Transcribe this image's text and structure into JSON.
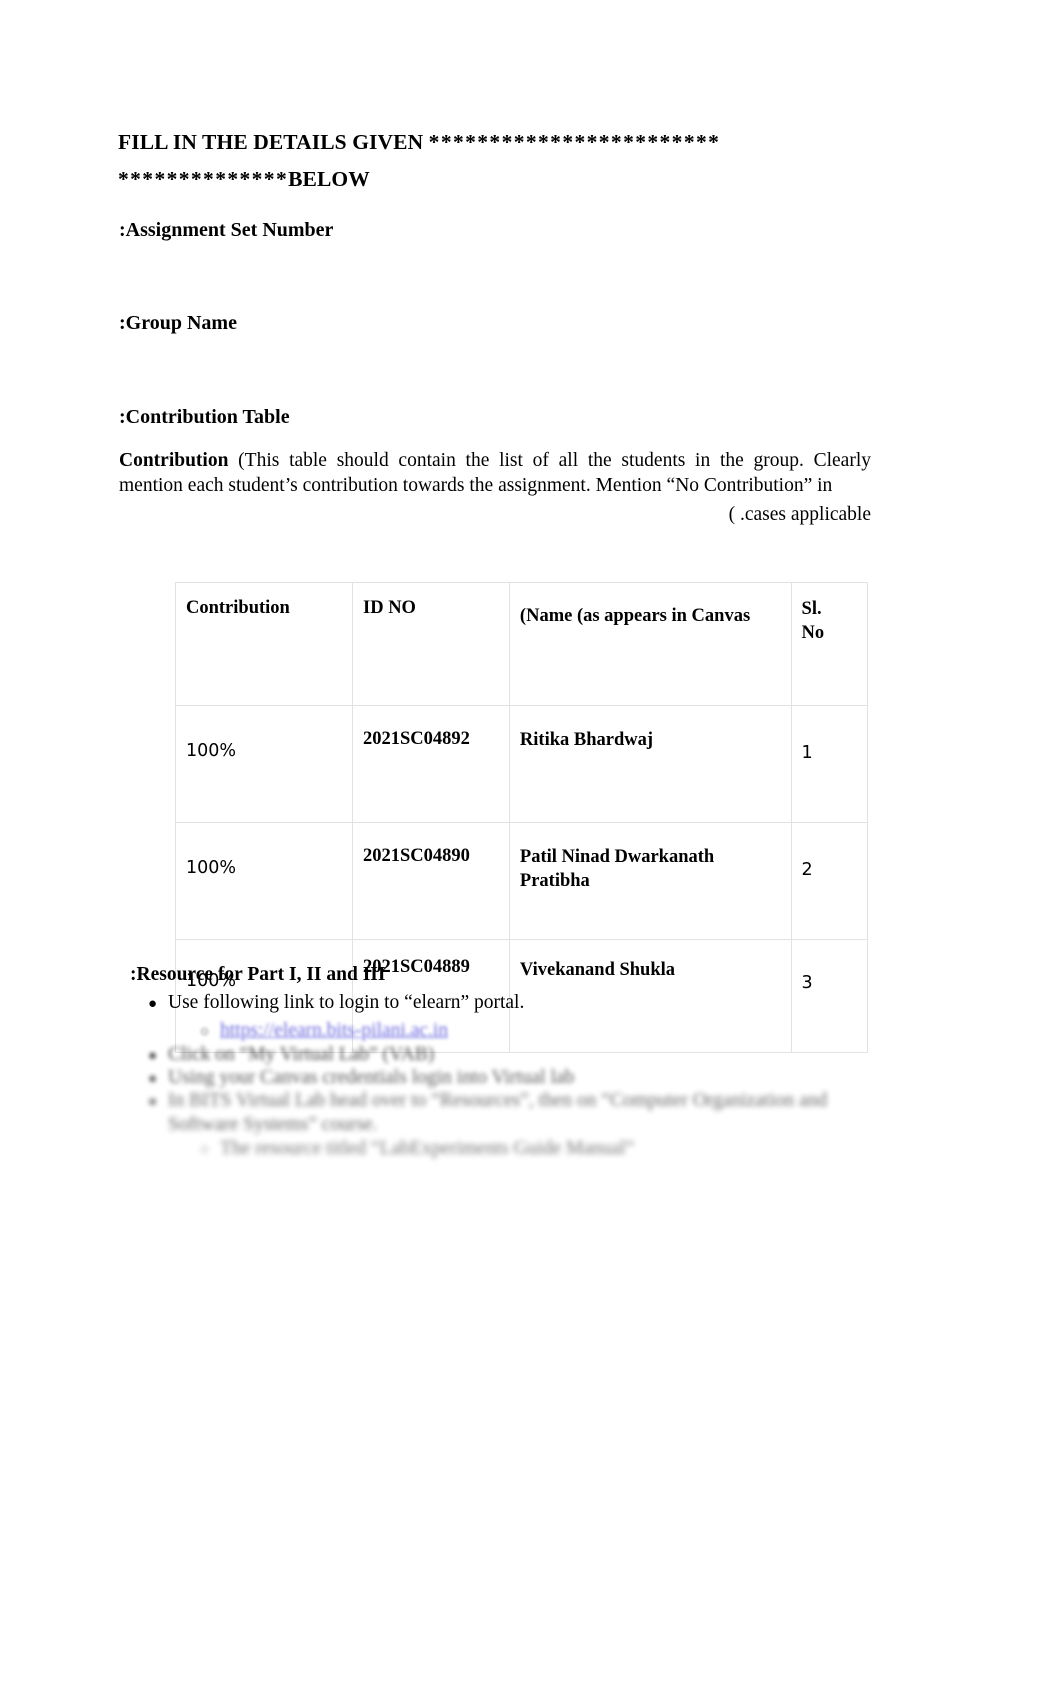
{
  "document": {
    "heading": {
      "text_prefix": "FILL IN THE DETAILS GIVEN ",
      "stars_line1": "************************",
      "stars_line2": "**************",
      "text_suffix": "BELOW"
    },
    "sections": {
      "assignment_set_number": ":Assignment Set Number",
      "group_name": ":Group Name",
      "contribution_table": ":Contribution Table",
      "resource": ":Resource for Part I, II and III"
    },
    "paragraph": {
      "lead": "Contribution",
      "body": " (This table should contain the list of all the students in the group. Clearly mention each student’s contribution towards the assignment. Mention “No Contribution” in",
      "tail": "( .cases applicable"
    },
    "table": {
      "headers": {
        "contribution": "Contribution",
        "id_no": "ID NO",
        "name": "(Name (as appears in Canvas",
        "sl_no": "Sl.\nNo"
      },
      "rows": [
        {
          "contribution": "100%",
          "id_no": "2021SC04892",
          "name": "Ritika Bhardwaj",
          "sl_no": "1"
        },
        {
          "contribution": "100%",
          "id_no": "2021SC04890",
          "name": "Patil Ninad Dwarkanath Pratibha",
          "sl_no": "2"
        },
        {
          "contribution": "100%",
          "id_no": "2021SC04889",
          "name": "Vivekanand Shukla",
          "sl_no": "3"
        }
      ]
    },
    "resource_list": {
      "bullet_glyph": "●",
      "sub_glyph": "○",
      "items": [
        "Use following link to login to “elearn” portal.",
        "https://elearn.bits-pilani.ac.in",
        "Click on “My Virtual Lab” (VAB)",
        "Using your Canvas credentials login into Virtual lab",
        "In BITS Virtual Lab head over to “Resources”, then on “Computer Organization and Software Systems” course.",
        "The resource titled “LabExperiments Guide Manual”"
      ]
    },
    "colors": {
      "link": "#4a46d6",
      "border": "#e2e2e2",
      "text": "#000000",
      "background": "#ffffff"
    }
  }
}
